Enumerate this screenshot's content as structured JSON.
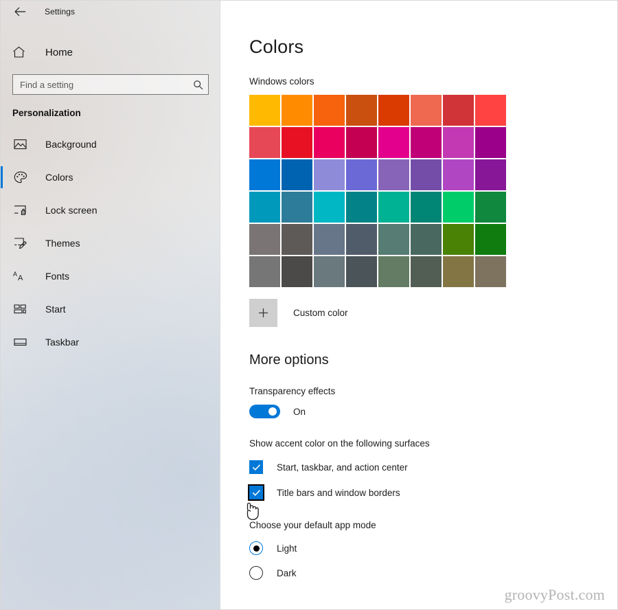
{
  "window": {
    "title": "Settings",
    "back_icon": "back-arrow-icon"
  },
  "sidebar": {
    "home": {
      "label": "Home",
      "icon": "home-icon"
    },
    "search": {
      "placeholder": "Find a setting",
      "value": "",
      "icon": "search-icon"
    },
    "section_title": "Personalization",
    "items": [
      {
        "label": "Background",
        "icon": "image-icon",
        "selected": false
      },
      {
        "label": "Colors",
        "icon": "palette-icon",
        "selected": true
      },
      {
        "label": "Lock screen",
        "icon": "lock-screen-icon",
        "selected": false
      },
      {
        "label": "Themes",
        "icon": "themes-brush-icon",
        "selected": false
      },
      {
        "label": "Fonts",
        "icon": "fonts-aa-icon",
        "selected": false
      },
      {
        "label": "Start",
        "icon": "start-tiles-icon",
        "selected": false
      },
      {
        "label": "Taskbar",
        "icon": "taskbar-icon",
        "selected": false
      }
    ]
  },
  "main": {
    "page_title": "Colors",
    "windows_colors_label": "Windows colors",
    "swatches": [
      "#ffb900",
      "#ff8c00",
      "#f7630c",
      "#ca5010",
      "#da3b01",
      "#ef6950",
      "#d13438",
      "#ff4343",
      "#e74856",
      "#e81123",
      "#ea005e",
      "#c30052",
      "#e3008c",
      "#bf0077",
      "#c239b3",
      "#9a0089",
      "#0078d7",
      "#0063b1",
      "#8e8cd8",
      "#6b69d6",
      "#8764b8",
      "#744da9",
      "#b146c2",
      "#881798",
      "#0099bc",
      "#2d7d9a",
      "#00b7c3",
      "#038387",
      "#00b294",
      "#018574",
      "#00cc6a",
      "#10893e",
      "#7a7574",
      "#5d5a58",
      "#68768a",
      "#515c6b",
      "#567c73",
      "#486860",
      "#498205",
      "#107c10",
      "#767676",
      "#4c4a48",
      "#69797e",
      "#4a5459",
      "#647c64",
      "#525e54",
      "#847545",
      "#7e735f"
    ],
    "custom_color": {
      "label": "Custom color",
      "icon": "plus-icon"
    },
    "more_options_title": "More options",
    "transparency": {
      "label": "Transparency effects",
      "state": "On",
      "checked": true
    },
    "accent_surfaces_label": "Show accent color on the following surfaces",
    "checkboxes": [
      {
        "label": "Start, taskbar, and action center",
        "checked": true,
        "focused": false
      },
      {
        "label": "Title bars and window borders",
        "checked": true,
        "focused": true
      }
    ],
    "app_mode_label": "Choose your default app mode",
    "app_modes": [
      {
        "label": "Light",
        "selected": true
      },
      {
        "label": "Dark",
        "selected": false
      }
    ]
  },
  "overlay": {
    "cursor_icon": "hand-pointer-cursor",
    "watermark": "groovyPost.com"
  },
  "colors": {
    "accent": "#0078d7",
    "sidebar_bg": "#e6e6e6",
    "main_bg": "#ffffff",
    "text": "#1d1d1d"
  }
}
